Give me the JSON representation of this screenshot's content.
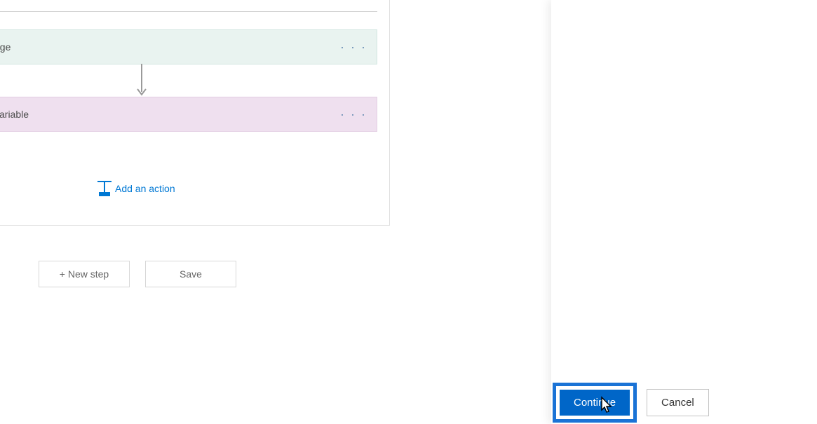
{
  "actions": {
    "card1_label": "age",
    "card2_label": "variable"
  },
  "links": {
    "add_action": "Add an action"
  },
  "buttons": {
    "new_step": "+ New step",
    "save": "Save"
  },
  "dialog": {
    "continue": "Continue",
    "cancel": "Cancel"
  }
}
